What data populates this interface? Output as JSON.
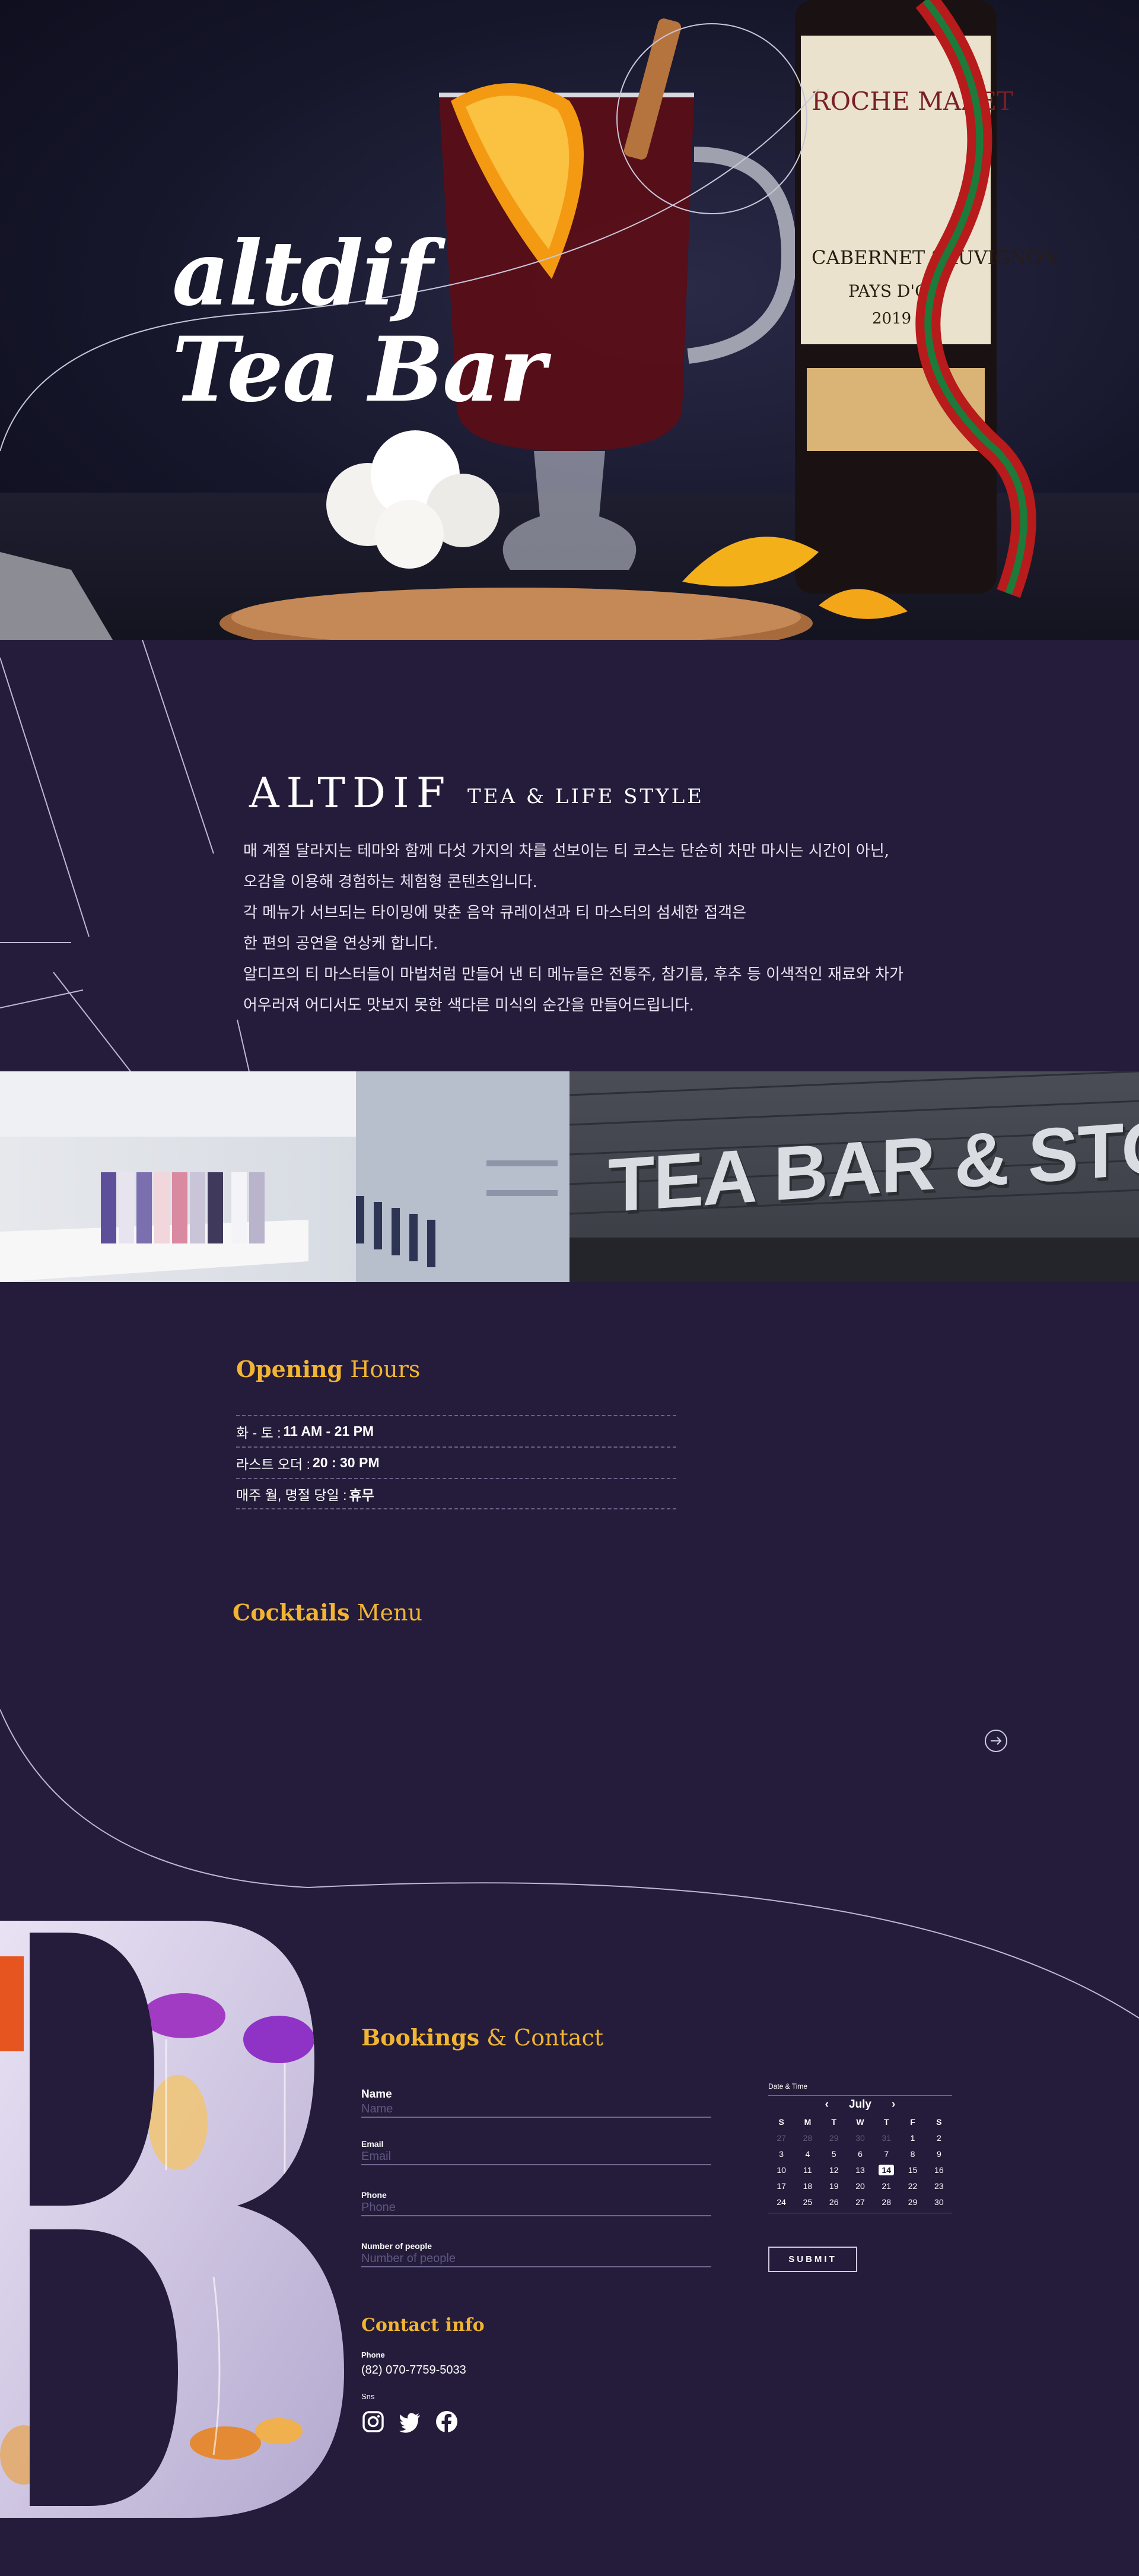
{
  "hero": {
    "title_line1": "altdif",
    "title_line2": "Tea Bar"
  },
  "intro": {
    "brand": "ALTDIF",
    "tagline": "TEA & LIFE STYLE",
    "lines": [
      "매 계절 달라지는 테마와 함께 다섯 가지의 차를 선보이는 티 코스는 단순히 차만 마시는 시간이 아닌,",
      "오감을 이용해 경험하는 체험형 콘텐츠입니다.",
      "각 메뉴가 서브되는 타이밍에 맞춘 음악 큐레이션과 티 마스터의 섬세한 접객은",
      "한 편의 공연을 연상케 합니다.",
      "알디프의 티 마스터들이 마법처럼 만들어 낸 티 메뉴들은 전통주, 참기름, 후추 등 이색적인 재료와 차가",
      "어우러져 어디서도 맛보지 못한 색다른 미식의 순간을 만들어드립니다."
    ]
  },
  "store_sign": "TEA BAR & STORE",
  "hours": {
    "title_a": "Opening",
    "title_b": "Hours",
    "rows": [
      {
        "label": "화 - 토 :",
        "value": "11 AM - 21 PM"
      },
      {
        "label": "라스트 오더 :",
        "value": "20 : 30 PM"
      },
      {
        "label": "매주 월, 명절 당일 :",
        "value": "휴무"
      }
    ]
  },
  "cocktails": {
    "title_a": "Cocktails",
    "title_b": "Menu"
  },
  "booking": {
    "title_a": "Bookings",
    "title_b": "& Contact",
    "name_label": "Name",
    "name_placeholder": "Name",
    "email_label": "Email",
    "email_placeholder": "Email",
    "phone_label": "Phone",
    "phone_placeholder": "Phone",
    "people_label": "Number of people",
    "people_placeholder": "Number of people",
    "submit_label": "SUBMIT"
  },
  "calendar": {
    "label": "Date & Time",
    "month": "July",
    "prev": "‹",
    "next": "›",
    "weekdays": [
      "S",
      "M",
      "T",
      "W",
      "T",
      "F",
      "S"
    ],
    "days": [
      {
        "d": "27",
        "muted": true
      },
      {
        "d": "28",
        "muted": true
      },
      {
        "d": "29",
        "muted": true
      },
      {
        "d": "30",
        "muted": true
      },
      {
        "d": "31",
        "muted": true
      },
      {
        "d": "1"
      },
      {
        "d": "2"
      },
      {
        "d": "3"
      },
      {
        "d": "4"
      },
      {
        "d": "5"
      },
      {
        "d": "6"
      },
      {
        "d": "7"
      },
      {
        "d": "8"
      },
      {
        "d": "9"
      },
      {
        "d": "10"
      },
      {
        "d": "11"
      },
      {
        "d": "12"
      },
      {
        "d": "13"
      },
      {
        "d": "14",
        "selected": true
      },
      {
        "d": "15"
      },
      {
        "d": "16"
      },
      {
        "d": "17"
      },
      {
        "d": "18"
      },
      {
        "d": "19"
      },
      {
        "d": "20"
      },
      {
        "d": "21"
      },
      {
        "d": "22"
      },
      {
        "d": "23"
      },
      {
        "d": "24"
      },
      {
        "d": "25"
      },
      {
        "d": "26"
      },
      {
        "d": "27"
      },
      {
        "d": "28"
      },
      {
        "d": "29"
      },
      {
        "d": "30"
      }
    ]
  },
  "contact": {
    "title": "Contact info",
    "phone_label": "Phone",
    "phone_value": "(82) 070-7759-5033",
    "sns_label": "Sns",
    "socials": [
      "instagram-icon",
      "twitter-icon",
      "facebook-icon"
    ]
  },
  "colors": {
    "background": "#241c3a",
    "accent": "#f2b531"
  }
}
